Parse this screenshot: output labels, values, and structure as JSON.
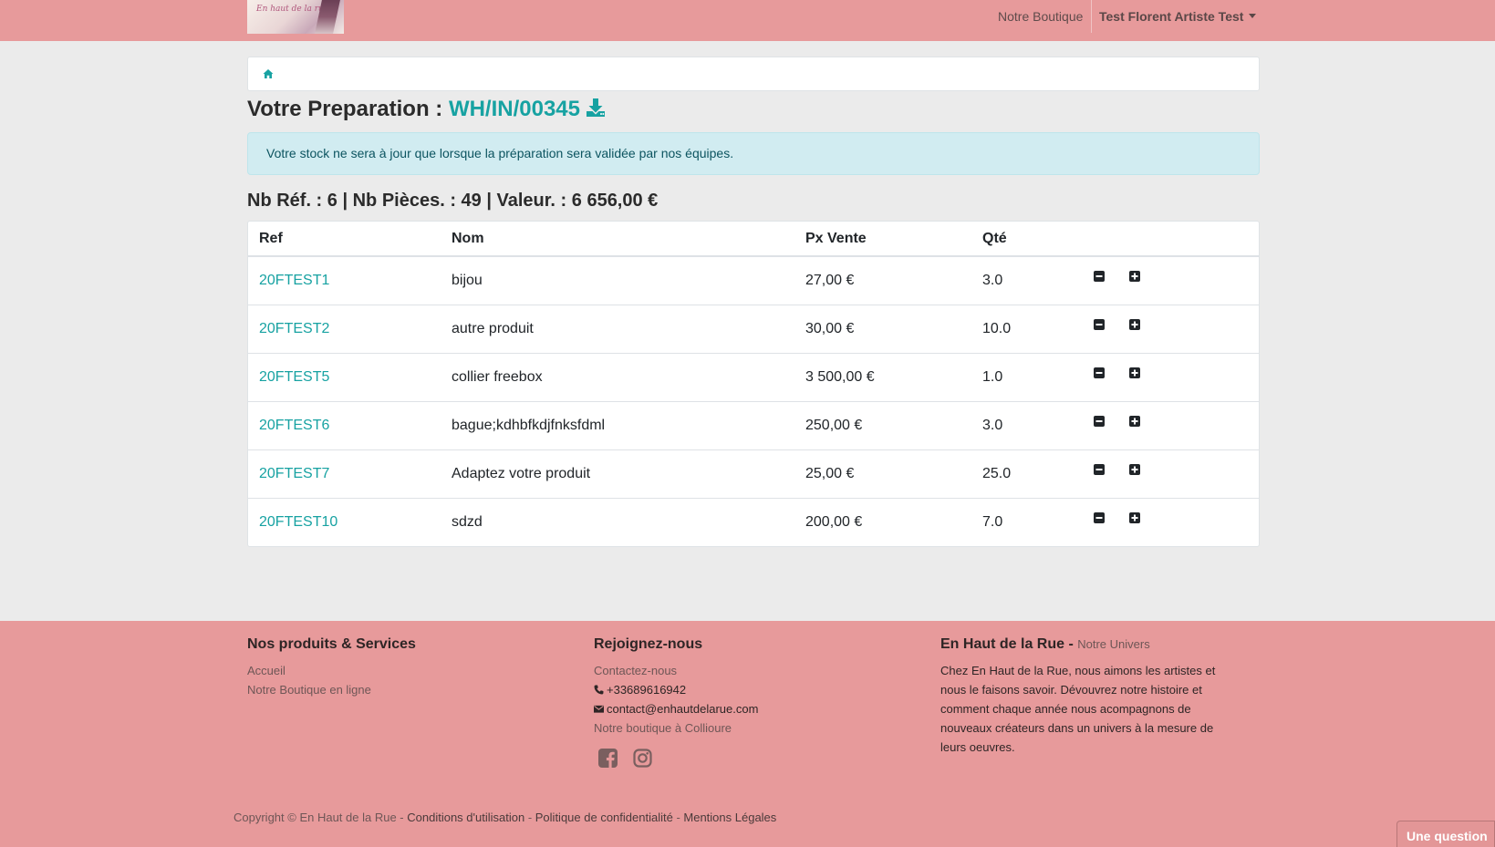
{
  "navbar": {
    "logo_text": "En haut de la rue",
    "boutique": "Notre Boutique",
    "user": "Test Florent Artiste Test"
  },
  "page": {
    "title_prefix": "Votre Preparation :",
    "title_ref": "WH/IN/00345",
    "alert": "Votre stock ne sera à jour que lorsque la préparation sera validée par nos équipes.",
    "stats": "Nb Réf. : 6 | Nb Pièces. : 49 | Valeur. : 6 656,00 €"
  },
  "table": {
    "headers": {
      "ref": "Ref",
      "nom": "Nom",
      "px": "Px Vente",
      "qte": "Qté"
    },
    "rows": [
      {
        "ref": "20FTEST1",
        "nom": "bijou",
        "px": "27,00 €",
        "qte": "3.0"
      },
      {
        "ref": "20FTEST2",
        "nom": "autre produit",
        "px": "30,00 €",
        "qte": "10.0"
      },
      {
        "ref": "20FTEST5",
        "nom": "collier freebox",
        "px": "3 500,00 €",
        "qte": "1.0"
      },
      {
        "ref": "20FTEST6",
        "nom": "bague;kdhbfkdjfnksfdml",
        "px": "250,00 €",
        "qte": "3.0"
      },
      {
        "ref": "20FTEST7",
        "nom": "Adaptez votre produit",
        "px": "25,00 €",
        "qte": "25.0"
      },
      {
        "ref": "20FTEST10",
        "nom": "sdzd",
        "px": "200,00 €",
        "qte": "7.0"
      }
    ]
  },
  "footer": {
    "col1": {
      "title": "Nos produits & Services",
      "links": [
        "Accueil",
        "Notre Boutique en ligne"
      ]
    },
    "col2": {
      "title": "Rejoignez-nous",
      "contact": "Contactez-nous",
      "phone": "+33689616942",
      "email": "contact@enhautdelarue.com",
      "shop": "Notre boutique à Collioure"
    },
    "col3": {
      "title": "En Haut de la Rue",
      "title_sep": " - ",
      "subtitle": "Notre Univers",
      "text_lines": [
        "Chez En Haut de la Rue, nous aimons les artistes et",
        "nous le faisons savoir. Dévouvrez notre histoire et",
        "comment chaque année nous acompagnons de",
        "nouveaux créateurs dans un univers à la mesure de",
        "leurs oeuvres."
      ]
    },
    "copyright": "Copyright © En Haut de la Rue",
    "sep": " - ",
    "links": [
      "Conditions d'utilisation",
      "Politique de confidentialité",
      "Mentions Légales"
    ],
    "question": "Une question"
  },
  "icons": [
    "home-icon",
    "download-icon",
    "minus-square-icon",
    "plus-square-icon",
    "phone-icon",
    "envelope-icon",
    "facebook-icon",
    "instagram-icon"
  ],
  "colors": {
    "navbar": "#e79a9b",
    "accent": "#17a2a2",
    "alert_bg": "#d1ecf1",
    "page_bg": "#ebebeb"
  }
}
